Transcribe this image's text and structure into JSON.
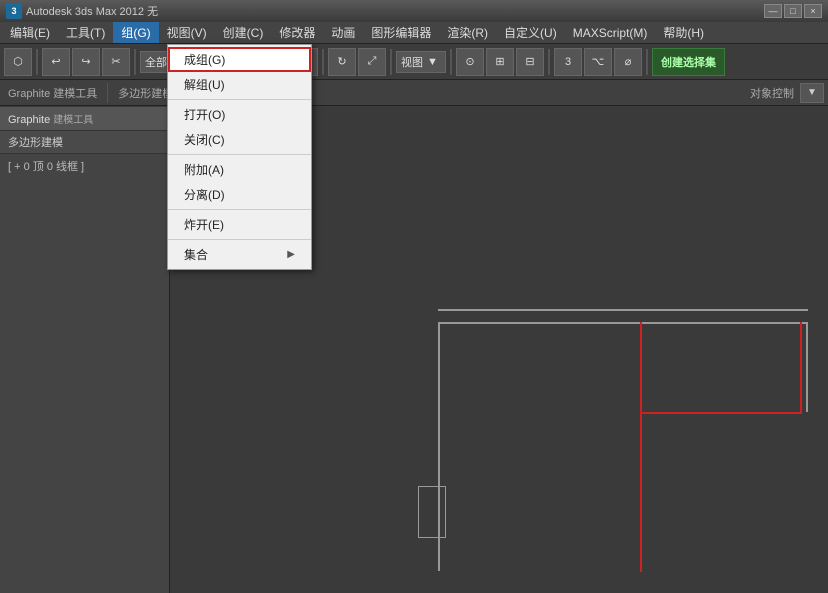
{
  "titlebar": {
    "title": "Autodesk 3ds Max 2012  无",
    "app_icon_label": "3",
    "win_btn_minimize": "—",
    "win_btn_maximize": "□",
    "win_btn_close": "×"
  },
  "menubar": {
    "items": [
      {
        "id": "edit",
        "label": "编辑(E)"
      },
      {
        "id": "tools",
        "label": "工具(T)"
      },
      {
        "id": "group",
        "label": "组(G)",
        "active": true
      },
      {
        "id": "view",
        "label": "视图(V)"
      },
      {
        "id": "create",
        "label": "创建(C)"
      },
      {
        "id": "modifier",
        "label": "修改器"
      },
      {
        "id": "animation",
        "label": "动画"
      },
      {
        "id": "graph-editor",
        "label": "图形编辑器"
      },
      {
        "id": "render",
        "label": "渲染(R)"
      },
      {
        "id": "customize",
        "label": "自定义(U)"
      },
      {
        "id": "maxscript",
        "label": "MAXScript(M)"
      },
      {
        "id": "help",
        "label": "帮助(H)"
      }
    ]
  },
  "dropdown": {
    "items": [
      {
        "id": "group-g",
        "label": "成组(G)",
        "highlighted": true
      },
      {
        "id": "ungroup-u",
        "label": "解组(U)"
      },
      {
        "id": "sep1",
        "separator": true
      },
      {
        "id": "open-o",
        "label": "打开(O)"
      },
      {
        "id": "close-c",
        "label": "关闭(C)"
      },
      {
        "id": "sep2",
        "separator": true
      },
      {
        "id": "attach-a",
        "label": "附加(A)"
      },
      {
        "id": "detach-d",
        "label": "分离(D)"
      },
      {
        "id": "sep3",
        "separator": true
      },
      {
        "id": "explode-e",
        "label": "炸开(E)"
      },
      {
        "id": "sep4",
        "separator": true
      },
      {
        "id": "assembly",
        "label": "集合",
        "has_arrow": true
      }
    ]
  },
  "toolbar": {
    "all_label": "全部",
    "view_dropdown": "视图",
    "create_selection_btn": "创建选择集"
  },
  "toolbar2": {
    "graphite_label": "Graphite 建模工具",
    "polygon_modeling_label": "多边形建模",
    "object_control_label": "对象控制"
  },
  "left_panel": {
    "header": "Graphite",
    "subheader": "多边形建模",
    "info": "[ + 0 顶 0 线框 ]"
  },
  "viewport": {
    "label": "[ + 0 顶 0 线框 ]"
  }
}
